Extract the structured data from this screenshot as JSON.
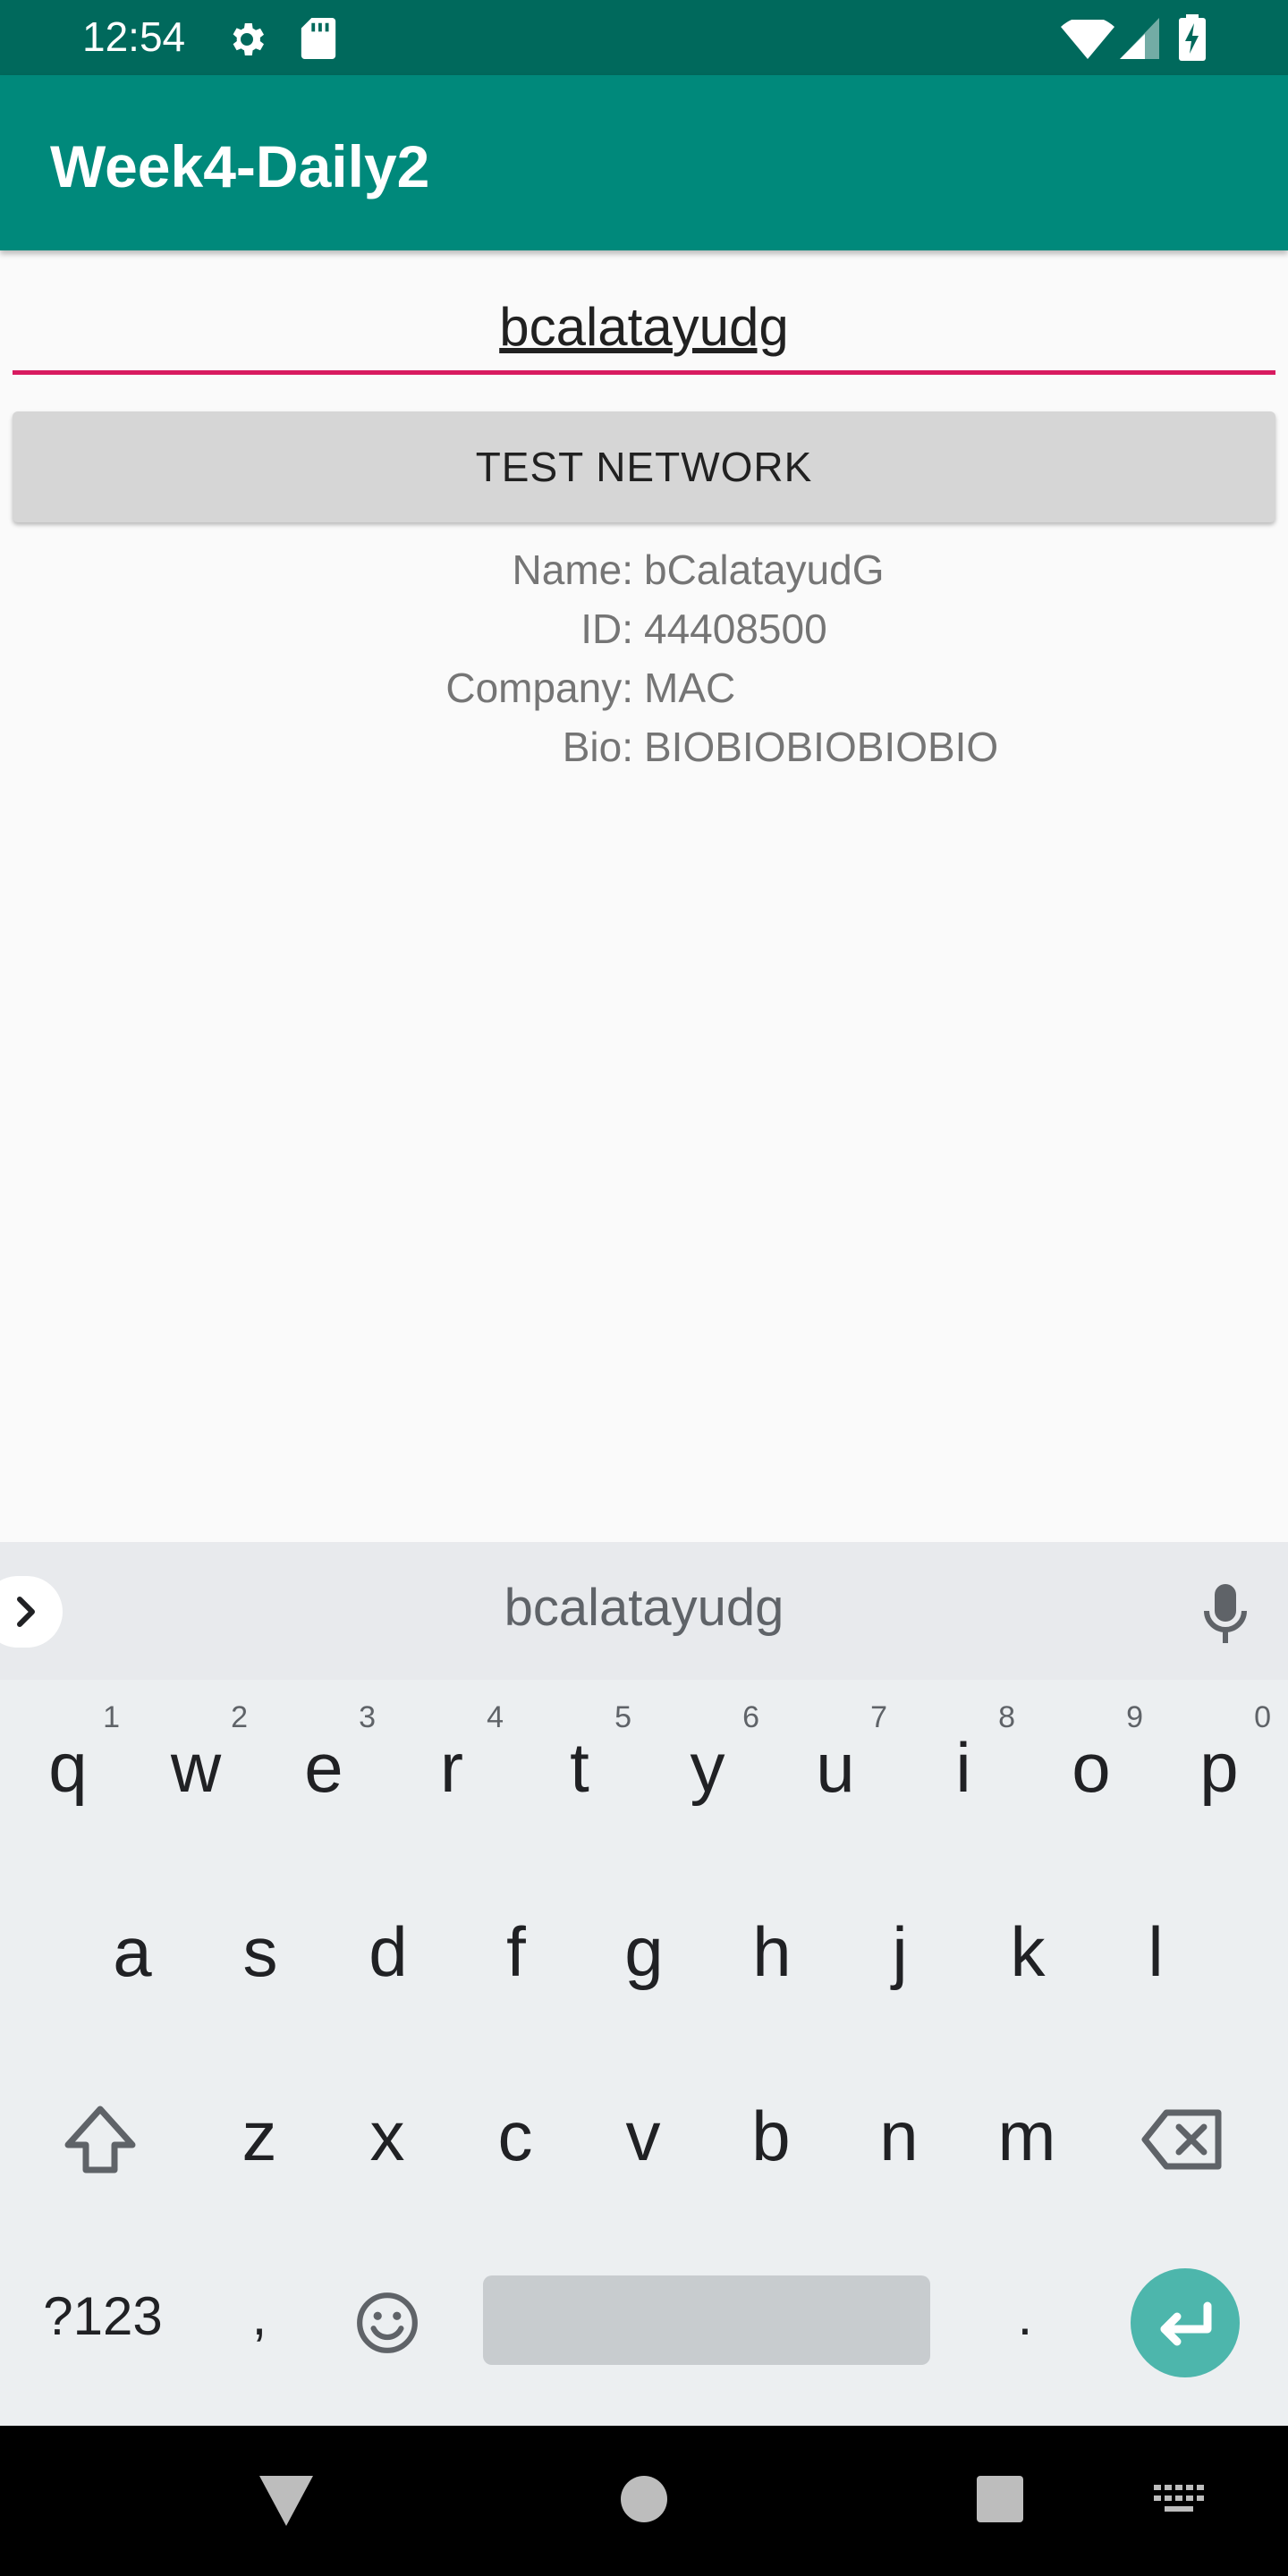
{
  "status_bar": {
    "time": "12:54"
  },
  "app_bar": {
    "title": "Week4-Daily2"
  },
  "input": {
    "value": "bcalatayudg"
  },
  "button": {
    "label": "TEST NETWORK"
  },
  "info": [
    {
      "label": "Name:",
      "value": "bCalatayudG"
    },
    {
      "label": "ID:",
      "value": "44408500"
    },
    {
      "label": "Company:",
      "value": "MAC"
    },
    {
      "label": "Bio:",
      "value": "BIOBIOBIOBIOBIO"
    }
  ],
  "keyboard": {
    "suggestion": "bcalatayudg",
    "row1": [
      {
        "key": "q",
        "hint": "1"
      },
      {
        "key": "w",
        "hint": "2"
      },
      {
        "key": "e",
        "hint": "3"
      },
      {
        "key": "r",
        "hint": "4"
      },
      {
        "key": "t",
        "hint": "5"
      },
      {
        "key": "y",
        "hint": "6"
      },
      {
        "key": "u",
        "hint": "7"
      },
      {
        "key": "i",
        "hint": "8"
      },
      {
        "key": "o",
        "hint": "9"
      },
      {
        "key": "p",
        "hint": "0"
      }
    ],
    "row2": [
      "a",
      "s",
      "d",
      "f",
      "g",
      "h",
      "j",
      "k",
      "l"
    ],
    "row3": [
      "z",
      "x",
      "c",
      "v",
      "b",
      "n",
      "m"
    ],
    "symbols_label": "?123",
    "comma": ",",
    "period": "."
  },
  "colors": {
    "primary": "#00897B",
    "primary_dark": "#00695C",
    "accent": "#D81B60",
    "enter": "#4DB6AC"
  }
}
